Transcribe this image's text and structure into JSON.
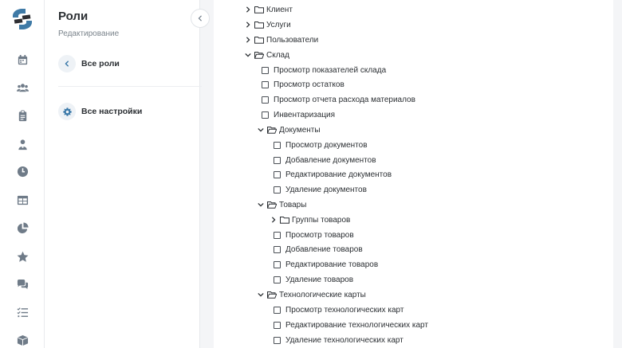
{
  "sidebar": {
    "title": "Роли",
    "subtitle": "Редактирование",
    "back_label": "Все роли",
    "settings_label": "Все настройки"
  },
  "rail_icons": [
    "calendar-icon",
    "users-icon",
    "clipboard-icon",
    "user-icon",
    "clock-icon",
    "table-icon",
    "pie-chart-icon",
    "star-icon",
    "chat-icon",
    "checklist-icon",
    "box-icon"
  ],
  "tree": {
    "klient": "Клиент",
    "uslugi": "Услуги",
    "polzovateli": "Пользователи",
    "sklad": "Склад",
    "sklad_items": [
      "Просмотр показателей склада",
      "Просмотр остатков",
      "Просмотр отчета расхода материалов",
      "Инвентаризация"
    ],
    "dokumenty": "Документы",
    "dokumenty_items": [
      "Просмотр документов",
      "Добавление документов",
      "Редактирование документов",
      "Удаление документов"
    ],
    "tovary": "Товары",
    "gruppy": "Группы товаров",
    "tovary_items": [
      "Просмотр товаров",
      "Добавление товаров",
      "Редактирование товаров",
      "Удаление товаров"
    ],
    "tehkarty": "Технологические карты",
    "tehkarty_items": [
      "Просмотр технологических карт",
      "Редактирование технологических карт",
      "Удаление технологических карт"
    ]
  },
  "colors": {
    "accent": "#3a78a8",
    "icon_gray": "#6f7b88",
    "background": "#f4f5f7"
  }
}
